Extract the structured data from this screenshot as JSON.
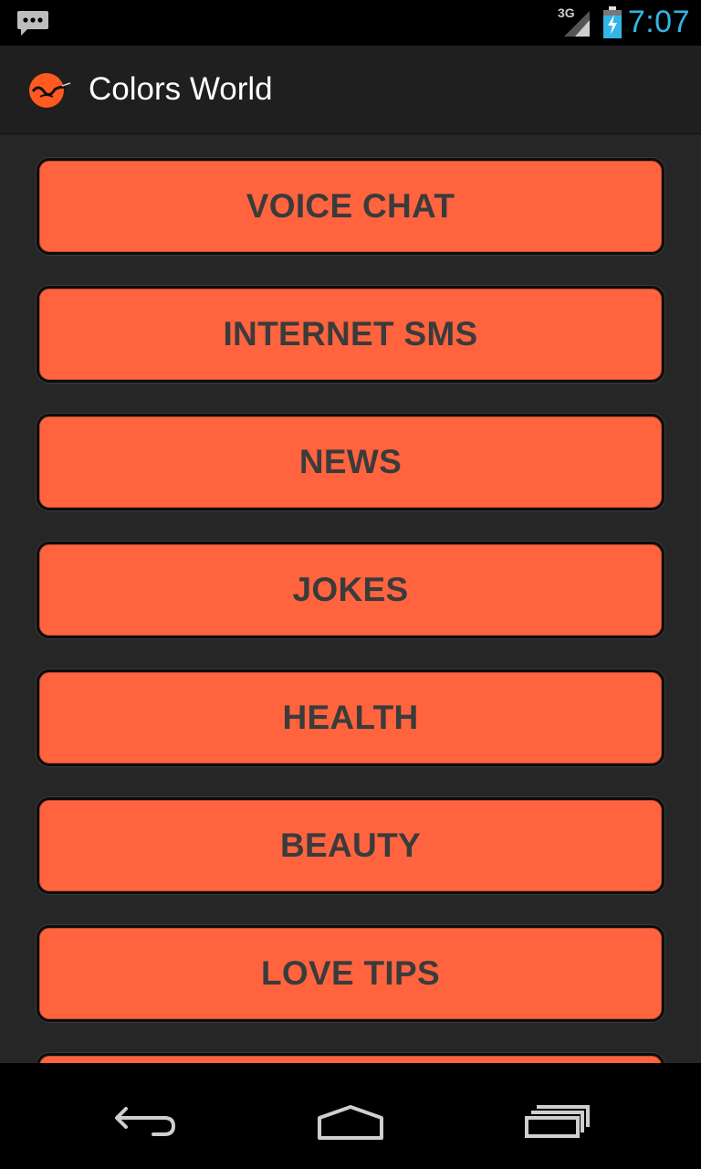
{
  "status_bar": {
    "network_type": "3G",
    "time": "7:07",
    "icons": [
      "notification-chat-icon",
      "signal-icon",
      "battery-charging-icon"
    ]
  },
  "action_bar": {
    "app_icon": "app-logo-icon",
    "title": "Colors World"
  },
  "menu": {
    "items": [
      {
        "label": "VOICE CHAT"
      },
      {
        "label": "INTERNET SMS"
      },
      {
        "label": "NEWS"
      },
      {
        "label": "JOKES"
      },
      {
        "label": "HEALTH"
      },
      {
        "label": "BEAUTY"
      },
      {
        "label": "LOVE TIPS"
      },
      {
        "label": ""
      }
    ]
  },
  "nav_bar": {
    "icons": [
      "back-icon",
      "home-icon",
      "recent-apps-icon"
    ]
  },
  "colors": {
    "button_fill": "#ff643e",
    "button_text": "#3b3b3b",
    "content_bg": "#262626",
    "action_bar_bg": "#1f1f1f",
    "clock": "#33b5e5"
  }
}
